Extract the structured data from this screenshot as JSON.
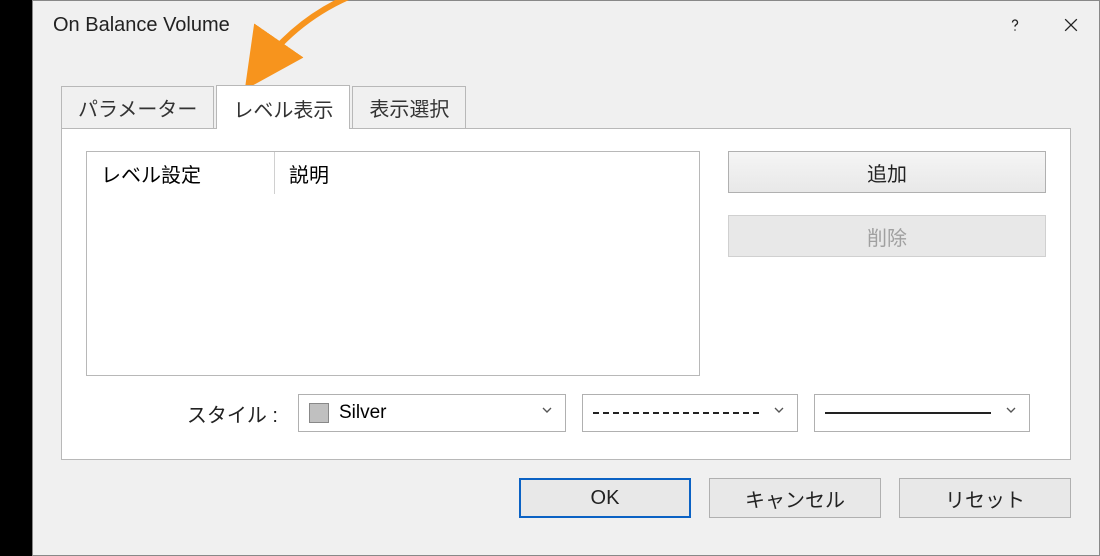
{
  "window": {
    "title": "On Balance Volume"
  },
  "tabs": {
    "t0": "パラメーター",
    "t1": "レベル表示",
    "t2": "表示選択"
  },
  "table": {
    "col1": "レベル設定",
    "col2": "説明"
  },
  "buttons": {
    "add": "追加",
    "delete": "削除"
  },
  "style": {
    "label": "スタイル :",
    "color_name": "Silver",
    "color_hex": "#c0c0c0"
  },
  "footer": {
    "ok": "OK",
    "cancel": "キャンセル",
    "reset": "リセット"
  }
}
